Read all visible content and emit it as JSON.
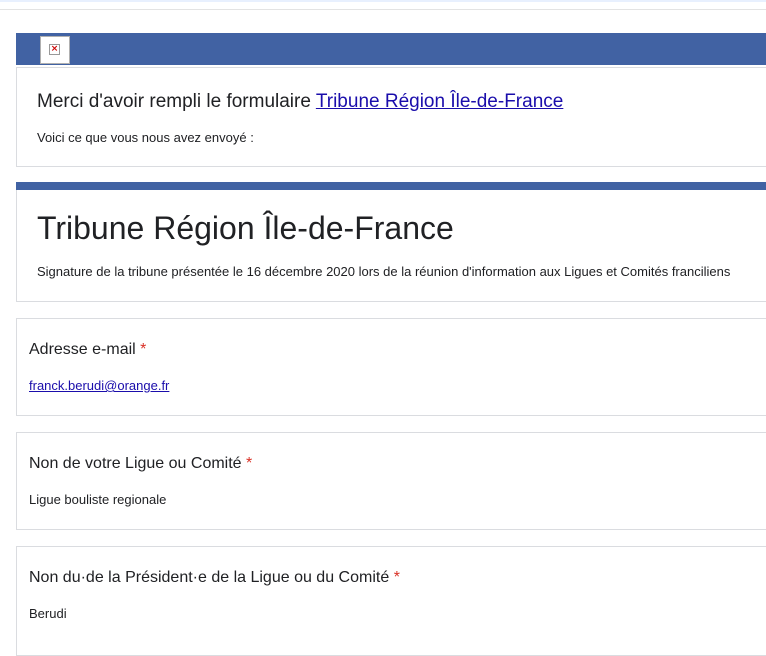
{
  "banner": {
    "image_state": "broken-image"
  },
  "confirmation": {
    "headline_prefix": "Merci d'avoir rempli le formulaire ",
    "form_link": "Tribune Région Île-de-France",
    "subtext": "Voici ce que vous nous avez envoyé :"
  },
  "form": {
    "title": "Tribune Région Île-de-France",
    "description": "Signature de la tribune présentée le 16 décembre 2020 lors de la réunion d'information aux Ligues et Comités franciliens"
  },
  "questions": [
    {
      "label": "Adresse e-mail",
      "required_mark": "*",
      "answer": "franck.berudi@orange.fr"
    },
    {
      "label": "Non de votre Ligue ou Comité",
      "required_mark": "*",
      "answer": "Ligue bouliste regionale"
    },
    {
      "label": "Non du·de la Président·e de la Ligue ou du Comité",
      "required_mark": "*",
      "answer": "Berudi"
    }
  ],
  "colors": {
    "accent": "#4162a3",
    "required": "#d93025",
    "link": "#1a0dab"
  }
}
